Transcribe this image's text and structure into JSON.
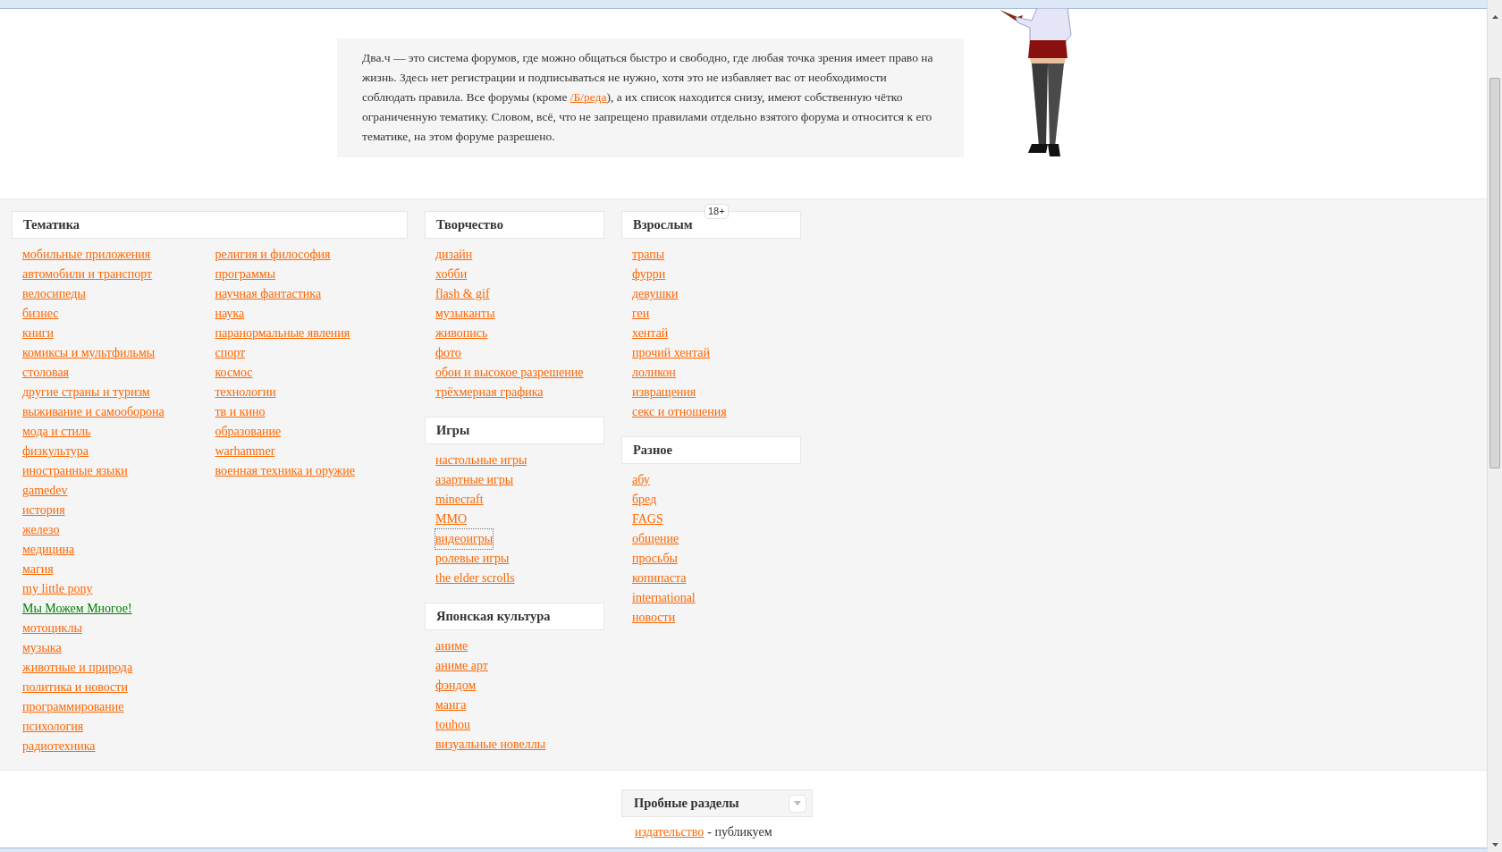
{
  "intro": {
    "before": "Два.ч — это система форумов, где можно общаться быстро и свободно, где любая точка зрения имеет право на жизнь. Здесь нет регистрации и подписываться не нужно, хотя это не избавляет вас от необходимости соблюдать правила. Все форумы (кроме ",
    "link": "/Б/реда",
    "after": "), а их список находится снизу, имеют собственную чётко ограниченную тематику. Словом, всё, что не запрещено правилами отдельно взятого форума и относится к его тематике, на этом форуме разрешено."
  },
  "columns": [
    {
      "sections": [
        {
          "title": "Тематика",
          "link_columns": [
            [
              {
                "label": "мобильные приложения"
              },
              {
                "label": "автомобили и транспорт"
              },
              {
                "label": "велосипеды"
              },
              {
                "label": "бизнес"
              },
              {
                "label": "книги"
              },
              {
                "label": "комиксы и мультфильмы"
              },
              {
                "label": "столовая"
              },
              {
                "label": "другие страны и туризм"
              },
              {
                "label": "выживание и самооборона"
              },
              {
                "label": "мода и стиль"
              },
              {
                "label": "физкультура"
              },
              {
                "label": "иностранные языки"
              },
              {
                "label": "gamedev"
              },
              {
                "label": "история"
              },
              {
                "label": "железо"
              },
              {
                "label": "медицина"
              },
              {
                "label": "магия"
              },
              {
                "label": "my little pony"
              },
              {
                "label": "Мы Можем Многое!",
                "color": "#008000"
              },
              {
                "label": "мотоциклы"
              },
              {
                "label": "музыка"
              },
              {
                "label": "животные и природа"
              },
              {
                "label": "политика и новости"
              },
              {
                "label": "программирование"
              },
              {
                "label": "психология"
              },
              {
                "label": "радиотехника"
              }
            ],
            [
              {
                "label": "религия и философия"
              },
              {
                "label": "программы"
              },
              {
                "label": "научная фантастика"
              },
              {
                "label": "наука"
              },
              {
                "label": "паранормальные явления"
              },
              {
                "label": "спорт"
              },
              {
                "label": "космос"
              },
              {
                "label": "технологии"
              },
              {
                "label": "тв и кино"
              },
              {
                "label": "образование"
              },
              {
                "label": "warhammer"
              },
              {
                "label": "военная техника и оружие"
              }
            ]
          ]
        }
      ]
    },
    {
      "sections": [
        {
          "title": "Творчество",
          "link_columns": [
            [
              {
                "label": "дизайн"
              },
              {
                "label": "хобби"
              },
              {
                "label": "flash & gif"
              },
              {
                "label": "музыканты"
              },
              {
                "label": "живопись"
              },
              {
                "label": "фото"
              },
              {
                "label": "обои и высокое разрешение"
              },
              {
                "label": "трёхмерная графика"
              }
            ]
          ]
        },
        {
          "title": "Игры",
          "link_columns": [
            [
              {
                "label": "настольные игры"
              },
              {
                "label": "азартные игры"
              },
              {
                "label": "minecraft"
              },
              {
                "label": "MMO"
              },
              {
                "label": "видеоигры",
                "focused": true
              },
              {
                "label": "ролевые игры"
              },
              {
                "label": "the elder scrolls"
              }
            ]
          ]
        },
        {
          "title": "Японская культура",
          "link_columns": [
            [
              {
                "label": "аниме"
              },
              {
                "label": "аниме арт"
              },
              {
                "label": "фэндом"
              },
              {
                "label": "манга"
              },
              {
                "label": "touhou"
              },
              {
                "label": "визуальные новеллы"
              }
            ]
          ]
        }
      ]
    },
    {
      "sections": [
        {
          "title": "Взрослым",
          "badge": "18+",
          "link_columns": [
            [
              {
                "label": "трапы"
              },
              {
                "label": "фурри"
              },
              {
                "label": "девушки"
              },
              {
                "label": "геи"
              },
              {
                "label": "хентай"
              },
              {
                "label": "прочий хентай"
              },
              {
                "label": "лоликон"
              },
              {
                "label": "извращения"
              },
              {
                "label": "секс и отношения"
              }
            ]
          ]
        },
        {
          "title": "Разное",
          "link_columns": [
            [
              {
                "label": "абу"
              },
              {
                "label": "бред"
              },
              {
                "label": "FAGS"
              },
              {
                "label": "общение"
              },
              {
                "label": "просьбы"
              },
              {
                "label": "копипаста"
              },
              {
                "label": "international"
              },
              {
                "label": "новости"
              }
            ]
          ]
        }
      ]
    }
  ],
  "trial": {
    "title": "Пробные разделы",
    "entries": [
      {
        "link": "издательство",
        "description": "- публикуем"
      }
    ]
  }
}
